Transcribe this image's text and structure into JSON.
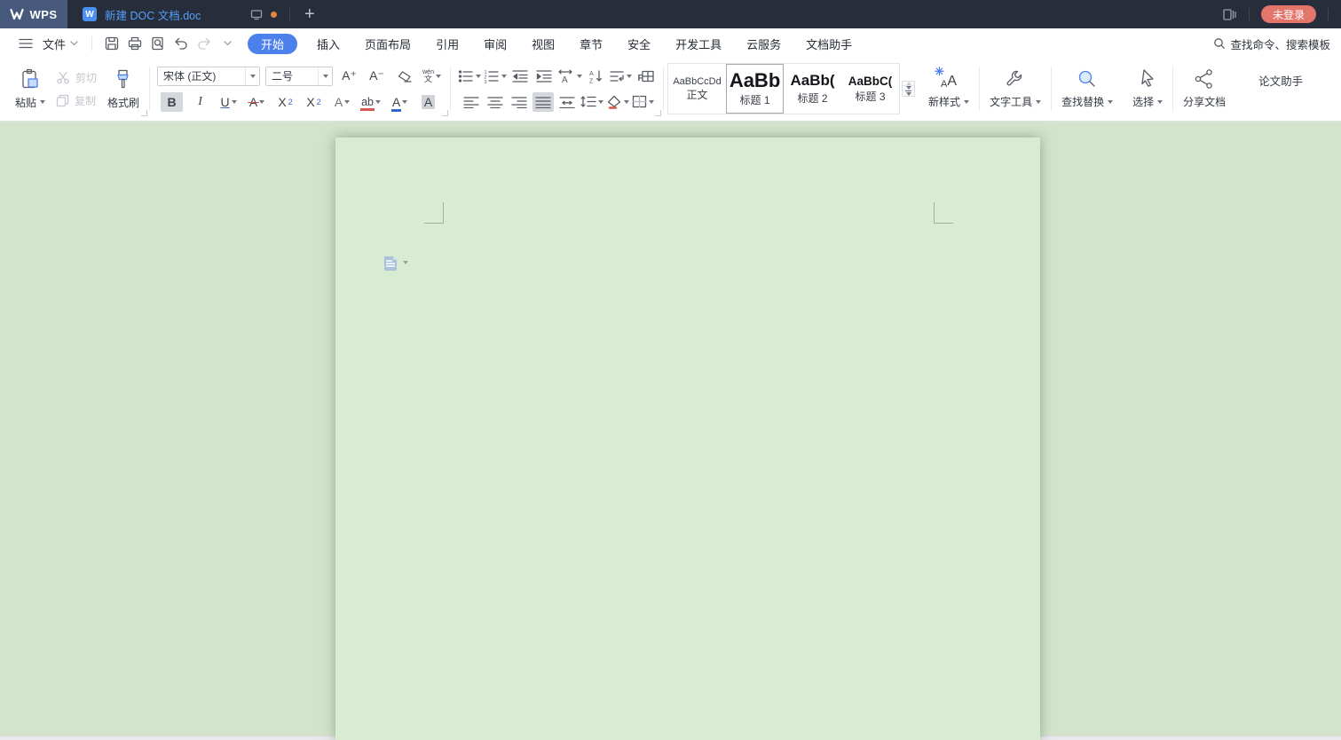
{
  "titlebar": {
    "logo_text": "WPS",
    "tab_icon_letter": "W",
    "tab_title": "新建 DOC 文档.doc",
    "new_tab_label": "+",
    "login_label": "未登录"
  },
  "menubar": {
    "file_label": "文件",
    "active_tab": "开始",
    "tabs": [
      "插入",
      "页面布局",
      "引用",
      "审阅",
      "视图",
      "章节",
      "安全",
      "开发工具",
      "云服务",
      "文档助手"
    ],
    "search_text": "查找命令、搜索模板"
  },
  "ribbon": {
    "clipboard": {
      "paste": "粘贴",
      "cut": "剪切",
      "copy": "复制",
      "format_painter": "格式刷"
    },
    "font": {
      "family": "宋体 (正文)",
      "size": "二号"
    },
    "glyphs": {
      "increase_font": "A⁺",
      "decrease_font": "A⁻",
      "pinyin_top": "wén",
      "pinyin_bottom": "文",
      "bold": "B",
      "italic": "I",
      "underline": "U",
      "strike": "A",
      "sup_base": "X",
      "sup_digit": "2",
      "sub_base": "X",
      "sub_digit": "2",
      "effect": "A",
      "highlight": "ab",
      "font_color": "A",
      "char_shade": "A",
      "num1": "1",
      "num2": "2",
      "num3": "3",
      "scale_a": "A",
      "sort_a": "A",
      "sort_z": "Z",
      "grid_f": "F",
      "new_style_a1": "A",
      "new_style_a2": "A",
      "asterisk": "✳"
    },
    "styles": [
      {
        "preview": "AaBbCcDd",
        "name": "正文",
        "selected": false
      },
      {
        "preview": "AaBb",
        "name": "标题 1",
        "selected": true
      },
      {
        "preview": "AaBb(",
        "name": "标题 2",
        "selected": false
      },
      {
        "preview": "AaBbC(",
        "name": "标题 3",
        "selected": false
      }
    ],
    "tools": {
      "new_style": "新样式",
      "text_tools": "文字工具",
      "find_replace": "查找替换",
      "select": "选择",
      "share": "分享文档",
      "paper_assistant": "论文助手"
    }
  },
  "colors": {
    "titlebar_bg": "#272d3b",
    "logo_bg": "#475a7e",
    "accent_blue": "#4c80ea",
    "tab_title_blue": "#55a0f8",
    "login_red": "#e4756b",
    "workspace_green": "#d2e5cc",
    "page_green": "#d8ecd1"
  }
}
